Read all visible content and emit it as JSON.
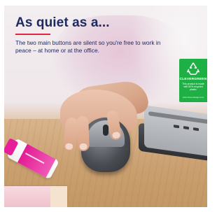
{
  "headline": "As quiet as a...",
  "subtext": "The two main buttons are silent so you're free to work in peace – at home or at the office.",
  "badge": {
    "title": "CLEVERGREEN",
    "text": "This product is made with 50% recycled plastic",
    "url": "www.cleverdesign.com",
    "icon": "recycle-icon",
    "color": "#1fb045"
  },
  "colors": {
    "headline": "#1f2a63",
    "accent": "#e4253f"
  }
}
